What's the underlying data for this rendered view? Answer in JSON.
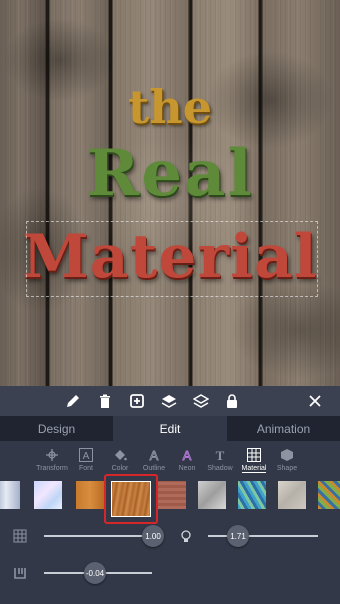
{
  "canvas": {
    "text_lines": [
      "the",
      "Real",
      "Material"
    ]
  },
  "toolbar": {
    "icons": [
      "pencil-icon",
      "trash-icon",
      "duplicate-icon",
      "layers-up-icon",
      "layers-icon",
      "lock-icon",
      "close-icon"
    ]
  },
  "tabs": [
    {
      "label": "Design"
    },
    {
      "label": "Edit"
    },
    {
      "label": "Animation"
    }
  ],
  "tools": [
    {
      "label": "Transform",
      "icon": "transform-icon"
    },
    {
      "label": "Font",
      "icon": "font-icon"
    },
    {
      "label": "Color",
      "icon": "paint-bucket-icon"
    },
    {
      "label": "Outline",
      "icon": "outline-icon"
    },
    {
      "label": "Neon",
      "icon": "neon-icon"
    },
    {
      "label": "Shadow",
      "icon": "shadow-icon"
    },
    {
      "label": "Material",
      "icon": "material-grid-icon",
      "active": true
    },
    {
      "label": "Shape",
      "icon": "shape-icon"
    }
  ],
  "sliders": {
    "size": {
      "value": "1.00",
      "icon": "grid-size-icon"
    },
    "light": {
      "value": "1.71",
      "icon": "light-bulb-icon"
    },
    "depth": {
      "value": "-0.04",
      "icon": "depth-icon"
    }
  },
  "selected_material": "wood-planks"
}
